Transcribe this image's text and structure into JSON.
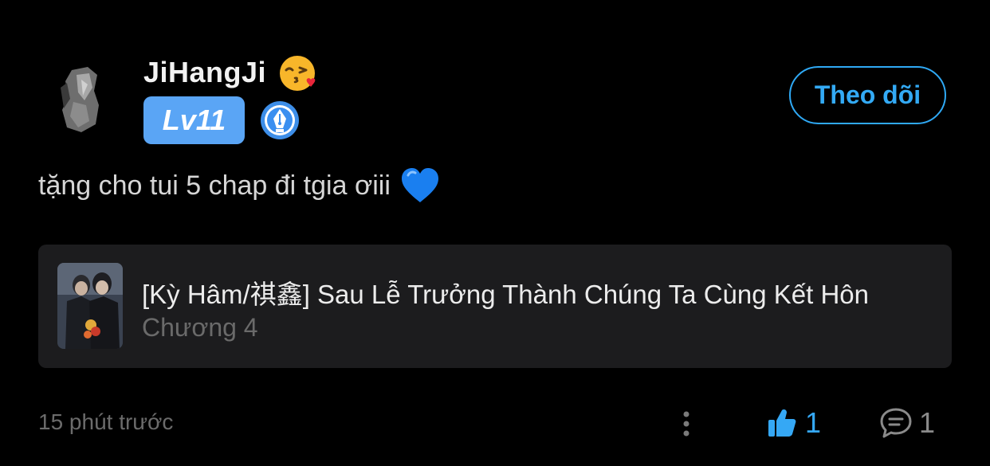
{
  "post": {
    "username": "JiHangJi",
    "name_emoji_icon": "face-blowing-kiss-icon",
    "level": "Lv11",
    "level_badge_color": "#5aa5f5",
    "writer_badge_icon": "fountain-pen-badge-icon",
    "follow_label": "Theo dõi",
    "follow_color": "#33aaf5",
    "comment_text": "tặng cho tui 5 chap đi tgia ơiii",
    "comment_emoji_icon": "blue-heart-icon",
    "timestamp": "15 phút trước"
  },
  "story": {
    "title": "[Kỳ Hâm/祺鑫] Sau Lễ Trưởng Thành Chúng Ta Cùng Kết Hôn",
    "chapter": "Chương 4",
    "cover_icon": "story-cover-image"
  },
  "actions": {
    "more_icon": "more-vertical-icon",
    "like_icon": "thumbs-up-icon",
    "like_count": "1",
    "like_color": "#35a8f5",
    "comment_icon": "comment-bubble-icon",
    "comment_count": "1"
  }
}
